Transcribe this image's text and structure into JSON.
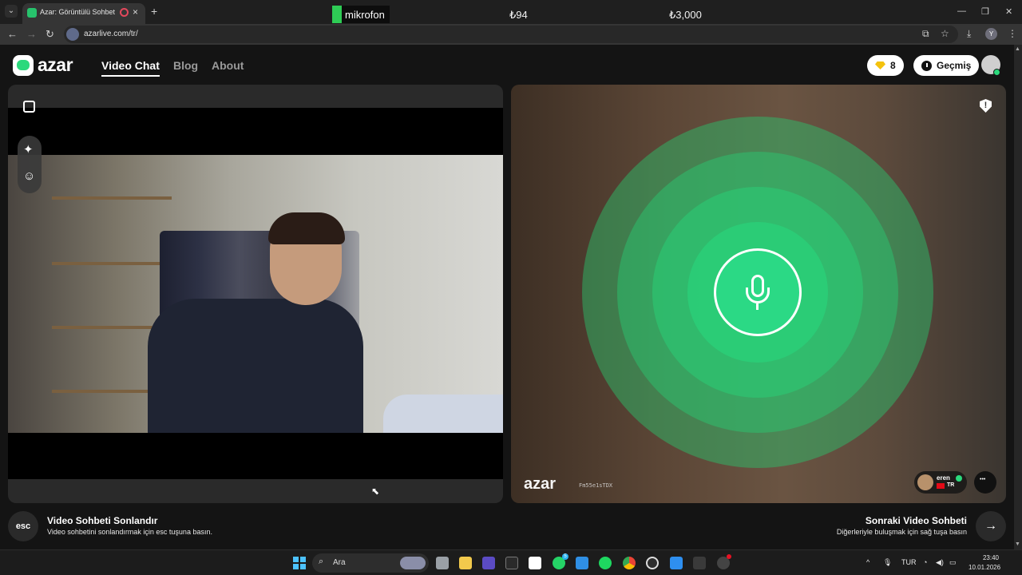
{
  "browser": {
    "tab_title": "Azar: Görüntülü Sohbet & V",
    "new_tab": "+",
    "url": "azarlive.com/tr/",
    "profile_initial": "Y"
  },
  "overlay": {
    "mic_label": "mikrofon",
    "value_1": "₺94",
    "value_2": "₺3,000"
  },
  "header": {
    "logo_text": "azar",
    "nav": [
      "Video Chat",
      "Blog",
      "About"
    ],
    "gem_count": "8",
    "history_label": "Geçmiş"
  },
  "remote": {
    "watermark_logo": "azar",
    "watermark_id": "Fm55e1sTDX",
    "user_name": "eren",
    "country_code": "TR"
  },
  "footer": {
    "esc_key": "esc",
    "end_title": "Video Sohbeti Sonlandır",
    "end_sub": "Video sohbetini sonlandırmak için esc tuşuna basın.",
    "next_title": "Sonraki Video Sohbeti",
    "next_sub": "Diğerleriyle buluşmak için sağ tuşa basın",
    "next_arrow": "→"
  },
  "taskbar": {
    "search_placeholder": "Ara",
    "language": "TUR",
    "time": "23:40",
    "date": "10.01.2026",
    "whatsapp_badge": "5"
  },
  "colors": {
    "brand_green": "#2bd97c",
    "gem_yellow": "#f4c20d"
  }
}
